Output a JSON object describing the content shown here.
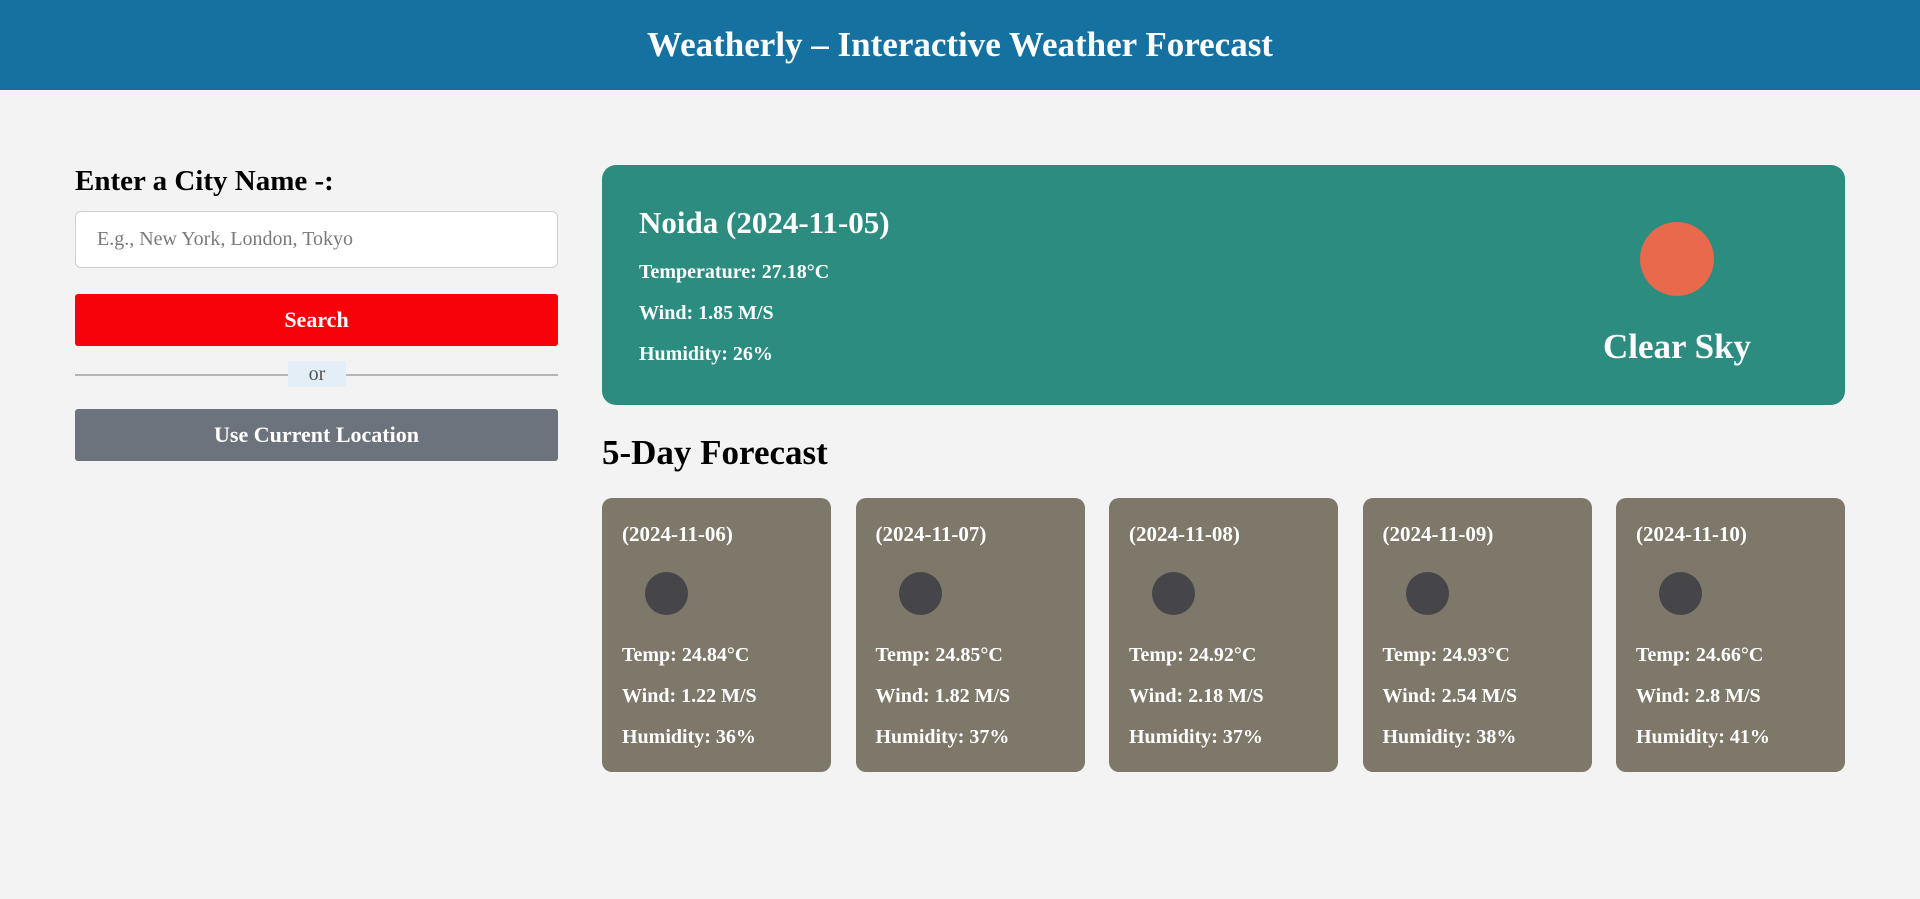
{
  "header": {
    "title": "Weatherly – Interactive Weather Forecast"
  },
  "search": {
    "heading": "Enter a City Name -:",
    "placeholder": "E.g., New York, London, Tokyo",
    "value": "",
    "search_label": "Search",
    "divider_label": "or",
    "location_label": "Use Current Location"
  },
  "current": {
    "title": "Noida (2024-11-05)",
    "temperature": "Temperature: 27.18°C",
    "wind": "Wind: 1.85 M/S",
    "humidity": "Humidity: 26%",
    "description": "Clear Sky",
    "icon": "sun-icon",
    "icon_color": "#e8694b"
  },
  "forecast": {
    "title": "5-Day Forecast",
    "days": [
      {
        "date": "(2024-11-06)",
        "temp": "Temp: 24.84°C",
        "wind": "Wind: 1.22 M/S",
        "humidity": "Humidity: 36%",
        "icon": "moon-icon"
      },
      {
        "date": "(2024-11-07)",
        "temp": "Temp: 24.85°C",
        "wind": "Wind: 1.82 M/S",
        "humidity": "Humidity: 37%",
        "icon": "moon-icon"
      },
      {
        "date": "(2024-11-08)",
        "temp": "Temp: 24.92°C",
        "wind": "Wind: 2.18 M/S",
        "humidity": "Humidity: 37%",
        "icon": "moon-icon"
      },
      {
        "date": "(2024-11-09)",
        "temp": "Temp: 24.93°C",
        "wind": "Wind: 2.54 M/S",
        "humidity": "Humidity: 38%",
        "icon": "moon-icon"
      },
      {
        "date": "(2024-11-10)",
        "temp": "Temp: 24.66°C",
        "wind": "Wind: 2.8 M/S",
        "humidity": "Humidity: 41%",
        "icon": "moon-icon"
      }
    ]
  },
  "colors": {
    "header_bg": "#1572a0",
    "current_card_bg": "#2d8c80",
    "forecast_card_bg": "#7e786a",
    "search_button": "#f7020b",
    "location_button": "#6c737c"
  }
}
